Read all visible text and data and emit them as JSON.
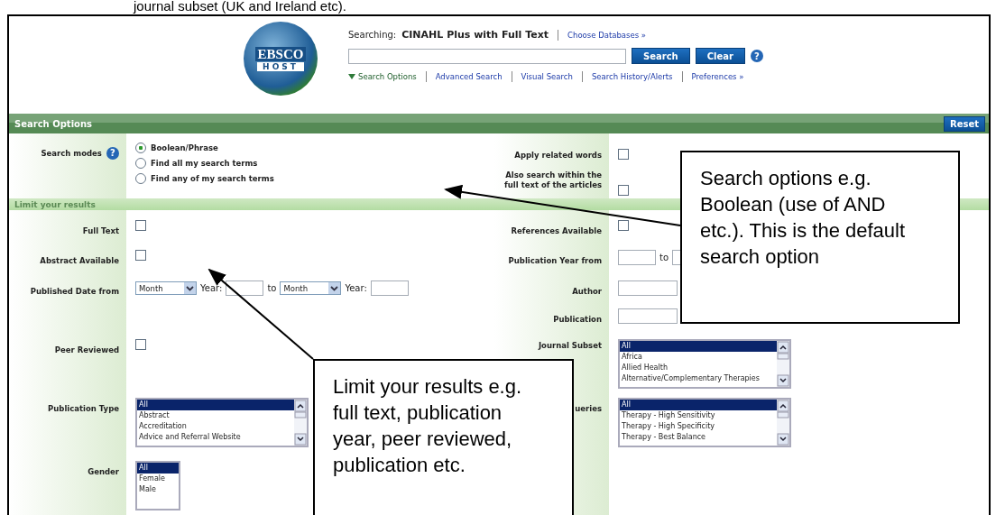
{
  "document_text": "journal subset (UK and Ireland etc).",
  "header": {
    "logo": {
      "line1": "EBSCO",
      "line2": "HOST"
    },
    "searching_label": "Searching:",
    "database": "CINAHL Plus with Full Text",
    "choose_link": "Choose Databases »",
    "search_button": "Search",
    "clear_button": "Clear",
    "help": "?",
    "options_toggle": {
      "label": "Search Options",
      "expanded": true
    },
    "links": [
      "Advanced Search",
      "Visual Search",
      "Search History/Alerts",
      "Preferences »"
    ]
  },
  "options_bar": {
    "title": "Search Options",
    "reset_button": "Reset"
  },
  "search_modes": {
    "label": "Search modes",
    "help": "?",
    "options": [
      {
        "label": "Boolean/Phrase",
        "selected": true
      },
      {
        "label": "Find all my search terms",
        "selected": false
      },
      {
        "label": "Find any of my search terms",
        "selected": false
      }
    ]
  },
  "right_options": [
    {
      "label": "Apply related words",
      "checked": false
    },
    {
      "label": "Also search within the full text of the articles",
      "checked": false
    }
  ],
  "limits_bar": {
    "title": "Limit your results"
  },
  "limit_rows": [
    {
      "left": {
        "kind": "checkbox",
        "label": "Full Text",
        "checked": false
      },
      "right": {
        "kind": "checkbox",
        "label": "References Available",
        "checked": false
      }
    },
    {
      "left": {
        "kind": "checkbox",
        "label": "Abstract Available",
        "checked": false
      },
      "right": {
        "kind": "year_range",
        "label": "Publication Year from",
        "to": "to"
      }
    },
    {
      "left": {
        "kind": "date_range",
        "label": "Published Date from",
        "month": "Month",
        "year_label": "Year:",
        "to": "to",
        "month2": "Month",
        "year_label2": "Year:"
      },
      "right": {
        "kind": "text",
        "label": "Author"
      }
    },
    {
      "right": {
        "kind": "text",
        "label": "Publication"
      }
    },
    {
      "left": {
        "kind": "checkbox",
        "label": "Peer Reviewed",
        "checked": false
      },
      "right": {
        "kind": "listbox",
        "label": "Journal Subset",
        "options": [
          {
            "label": "All",
            "selected": true
          },
          {
            "label": "Africa",
            "selected": false
          },
          {
            "label": "Allied Health",
            "selected": false
          },
          {
            "label": "Alternative/Complementary Therapies",
            "selected": false
          }
        ]
      }
    },
    {
      "left": {
        "kind": "listbox",
        "label": "Publication Type",
        "options": [
          {
            "label": "All",
            "selected": true
          },
          {
            "label": "Abstract",
            "selected": false
          },
          {
            "label": "Accreditation",
            "selected": false
          },
          {
            "label": "Advice and Referral Website",
            "selected": false
          }
        ]
      },
      "right": {
        "kind": "listbox",
        "label": "ueries",
        "options": [
          {
            "label": "All",
            "selected": true
          },
          {
            "label": "Therapy - High Sensitivity",
            "selected": false
          },
          {
            "label": "Therapy - High Specificity",
            "selected": false
          },
          {
            "label": "Therapy - Best Balance",
            "selected": false
          }
        ]
      }
    },
    {
      "left": {
        "kind": "short_listbox",
        "label": "Gender",
        "options": [
          {
            "label": "All",
            "selected": true
          },
          {
            "label": "Female",
            "selected": false
          },
          {
            "label": "Male",
            "selected": false
          }
        ]
      }
    }
  ],
  "callouts": [
    {
      "text": "Search options e.g. Boolean (use of AND etc.). This is the default search option"
    },
    {
      "text": "Limit your results e.g. full text, publication year, peer reviewed, publication etc."
    }
  ]
}
